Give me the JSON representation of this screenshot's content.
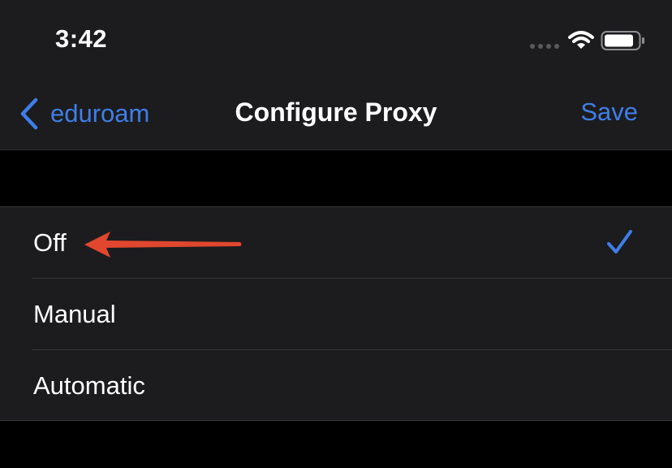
{
  "status_bar": {
    "time": "3:42",
    "icons": [
      "signal-icon",
      "wifi-icon",
      "battery-icon"
    ]
  },
  "nav": {
    "back_label": "eduroam",
    "back_icon": "chevron-left-icon",
    "title": "Configure Proxy",
    "save_label": "Save"
  },
  "options": [
    {
      "label": "Off",
      "selected": true
    },
    {
      "label": "Manual",
      "selected": false
    },
    {
      "label": "Automatic",
      "selected": false
    }
  ],
  "annotation": {
    "icon": "red-arrow-icon",
    "color": "#e0472e"
  },
  "colors": {
    "accent": "#3f7ee8",
    "background": "#000000",
    "surface": "#1c1c1e",
    "separator": "#38383a"
  }
}
